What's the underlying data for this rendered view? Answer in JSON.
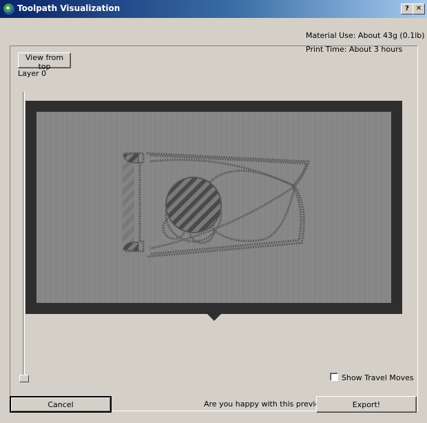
{
  "window": {
    "title": "Toolpath Visualization",
    "help_label": "?",
    "close_label": "✕"
  },
  "toolbar": {
    "view_top_label": "View from top"
  },
  "stats": {
    "material_use": "Material Use: About 43g (0.1lb)",
    "print_time": "Print Time: About 3 hours"
  },
  "layer": {
    "label": "Layer 0",
    "value": 0
  },
  "options": {
    "show_travel_label": "Show Travel Moves",
    "show_travel_checked": false
  },
  "footer": {
    "cancel_label": "Cancel",
    "question": "Are you happy with this preview?",
    "export_label": "Export!"
  },
  "colors": {
    "title_start": "#0a246a",
    "title_end": "#a6caf0",
    "panel": "#2e2e2e",
    "canvas": "#878787"
  }
}
